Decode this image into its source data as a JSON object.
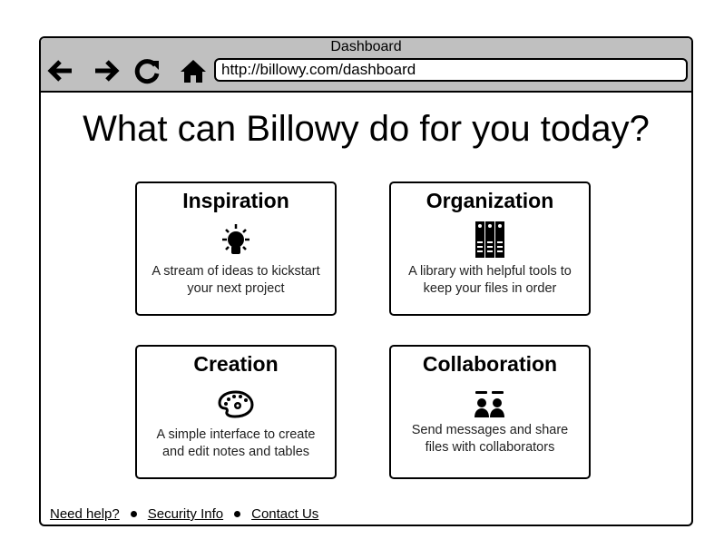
{
  "browser": {
    "title": "Dashboard",
    "url": "http://billowy.com/dashboard"
  },
  "heading": "What can Billowy do for you today?",
  "cards": [
    {
      "title": "Inspiration",
      "icon": "lightbulb-icon",
      "line1": "A stream of ideas to kickstart",
      "line2": "your next project"
    },
    {
      "title": "Organization",
      "icon": "binders-icon",
      "line1": "A library with helpful tools to",
      "line2": "keep your files in order"
    },
    {
      "title": "Creation",
      "icon": "palette-icon",
      "line1": "A simple interface to create",
      "line2": "and edit notes and tables"
    },
    {
      "title": "Collaboration",
      "icon": "users-chat-icon",
      "line1": "Send messages and share",
      "line2": "files with collaborators"
    }
  ],
  "footer": {
    "links": [
      "Need help?",
      "Security Info",
      "Contact Us"
    ]
  }
}
